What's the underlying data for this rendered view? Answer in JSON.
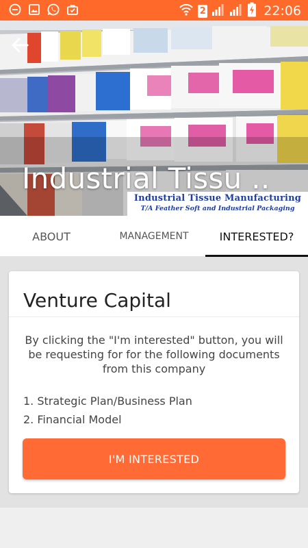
{
  "status_bar": {
    "time": "22:06",
    "sim_slot": "2",
    "left_icons": [
      "minus-circle-icon",
      "image-icon",
      "whatsapp-icon",
      "briefcase-icon"
    ],
    "right_icons": [
      "wifi-icon",
      "sim-badge",
      "signal-icon",
      "battery-charging-icon"
    ],
    "background_color": "#ff6a2a"
  },
  "hero": {
    "title": "Industrial Tissu ..",
    "banner_line1": "Industrial Tissue Manufacturing",
    "banner_line2": "T/A Feather Soft and Industrial Packaging",
    "back_icon": "back-arrow-icon"
  },
  "tabs": [
    {
      "label": "ABOUT",
      "active": false
    },
    {
      "label": "MANAGEMENT",
      "active": false
    },
    {
      "label": "INTERESTED?",
      "active": true
    }
  ],
  "card": {
    "title": "Venture Capital",
    "description": "By clicking the \"I'm interested\" button, you will be requesting for for the following documents from this company",
    "documents": [
      "1. Strategic Plan/Business Plan",
      "2. Financial Model"
    ],
    "button_label": "I'M INTERESTED"
  },
  "colors": {
    "accent": "#ff6a35",
    "banner_text": "#1f3da0",
    "active_tab_indicator": "#111111"
  }
}
